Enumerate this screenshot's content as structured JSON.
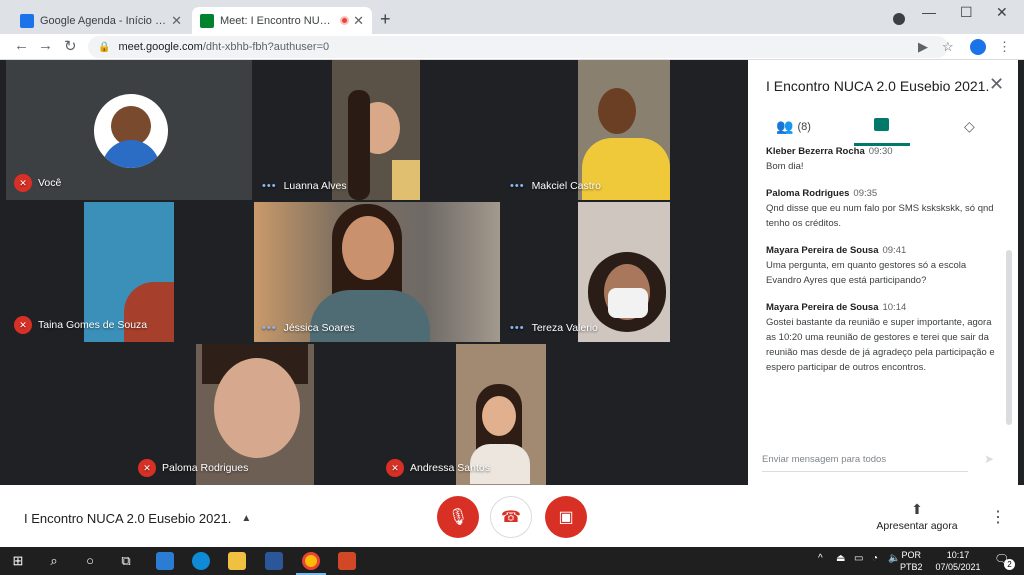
{
  "browser": {
    "tabs": [
      {
        "title": "Google Agenda - Início da progr..."
      },
      {
        "title": "Meet: I Encontro NUCA 2.0 E..."
      }
    ],
    "url_host": "meet.google.com",
    "url_path": "/dht-xbhb-fbh?authuser=0"
  },
  "participants": [
    {
      "name": "Você",
      "muted": true
    },
    {
      "name": "Luanna Alves",
      "muted": false
    },
    {
      "name": "Makciel Castro",
      "muted": false
    },
    {
      "name": "Taina Gomes de Souza",
      "muted": true
    },
    {
      "name": "Jéssica Soares",
      "muted": false
    },
    {
      "name": "Tereza Valerio",
      "muted": false
    },
    {
      "name": "Paloma Rodrigues",
      "muted": true
    },
    {
      "name": "Andressa Santos",
      "muted": true
    }
  ],
  "panel": {
    "title": "I Encontro NUCA 2.0 Eusebio 2021.",
    "people_count": "(8)",
    "messages": [
      {
        "author": "Kleber Bezerra Rocha",
        "time": "09:30",
        "text": "Bom dia!"
      },
      {
        "author": "Paloma Rodrigues",
        "time": "09:35",
        "text": "Qnd disse que eu num falo por SMS kskskskk, só qnd tenho os créditos."
      },
      {
        "author": "Mayara Pereira de Sousa",
        "time": "09:41",
        "text": "Uma pergunta, em quanto gestores só a escola Evandro Ayres que está participando?"
      },
      {
        "author": "Mayara Pereira de Sousa",
        "time": "10:14",
        "text": "Gostei bastante da reunião e super importante, agora as 10:20 uma reunião de gestores e terei que sair da reunião mas desde de já agradeço pela participação e espero participar de outros encontros."
      }
    ],
    "input_placeholder": "Enviar mensagem para todos"
  },
  "bottom": {
    "meeting_title": "I Encontro NUCA 2.0 Eusebio 2021.",
    "present_label": "Apresentar agora"
  },
  "taskbar": {
    "lang_top": "POR",
    "lang_bottom": "PTB2",
    "time": "10:17",
    "date": "07/05/2021",
    "notif_count": "2"
  }
}
